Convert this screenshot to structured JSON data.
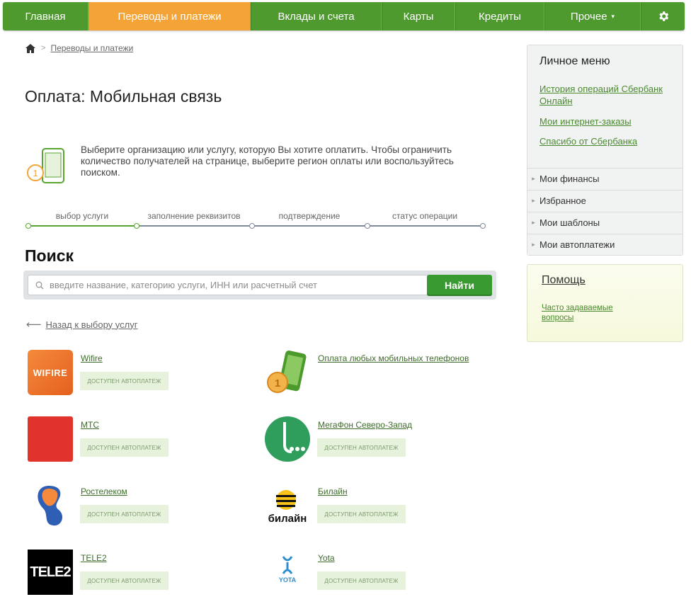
{
  "nav": {
    "items": [
      {
        "label": "Главная",
        "active": false
      },
      {
        "label": "Переводы и платежи",
        "active": true
      },
      {
        "label": "Вклады и счета",
        "active": false
      },
      {
        "label": "Карты",
        "active": false
      },
      {
        "label": "Кредиты",
        "active": false
      },
      {
        "label": "Прочее",
        "active": false,
        "caret": "▾"
      }
    ],
    "settings_icon": "gear-icon"
  },
  "breadcrumb": {
    "home_icon": "home-icon",
    "separator": ">",
    "item": "Переводы и платежи"
  },
  "page_title": "Оплата: Мобильная связь",
  "info": {
    "icon": "mobile-payment-icon",
    "text": "Выберите организацию или услугу, которую Вы хотите оплатить. Чтобы ограничить количество получателей на странице, выберите регион оплаты или воспользуйтесь поиском."
  },
  "steps": {
    "current_step": 1,
    "labels": [
      "выбор услуги",
      "заполнение реквизитов",
      "подтверждение",
      "статус операции"
    ]
  },
  "search": {
    "title": "Поиск",
    "placeholder": "введите название, категорию услуги, ИНН или расчетный счет",
    "value": "",
    "button": "Найти"
  },
  "back_link": {
    "arrow": "⟵",
    "label": "Назад к выбору услуг"
  },
  "providers": [
    {
      "name": "Wifire",
      "badge": "ДОСТУПЕН АВТОПЛАТЕЖ",
      "logo": "wifire-logo",
      "logo_text": "WIFIRE"
    },
    {
      "name": "Оплата любых мобильных телефонов",
      "badge": "",
      "logo": "mobile-phone-coin-icon"
    },
    {
      "name": "МТС",
      "badge": "ДОСТУПЕН АВТОПЛАТЕЖ",
      "logo": "mts-logo"
    },
    {
      "name": "МегаФон Северо-Запад",
      "badge": "ДОСТУПЕН АВТОПЛАТЕЖ",
      "logo": "megafon-logo"
    },
    {
      "name": "Ростелеком",
      "badge": "ДОСТУПЕН АВТОПЛАТЕЖ",
      "logo": "rostelecom-logo"
    },
    {
      "name": "Билайн",
      "badge": "ДОСТУПЕН АВТОПЛАТЕЖ",
      "logo": "beeline-logo",
      "logo_text": "билайн"
    },
    {
      "name": "TELE2",
      "badge": "ДОСТУПЕН АВТОПЛАТЕЖ",
      "logo": "tele2-logo",
      "logo_text": "TELE2"
    },
    {
      "name": "Yota",
      "badge": "ДОСТУПЕН АВТОПЛАТЕЖ",
      "logo": "yota-logo",
      "logo_text": "YOTA"
    }
  ],
  "personal_menu": {
    "title": "Личное меню",
    "links": [
      "История операций Сбербанк Онлайн",
      "Мои интернет-заказы",
      "Спасибо от Сбербанка"
    ],
    "sections": [
      "Мои финансы",
      "Избранное",
      "Мои шаблоны",
      "Мои автоплатежи"
    ]
  },
  "help": {
    "title": "Помощь",
    "faq": "Часто задаваемые вопросы"
  },
  "colors": {
    "nav_green": "#4e9a2e",
    "nav_active": "#f4a436",
    "button_green": "#3a9a32",
    "link_green": "#4a8a2e"
  }
}
